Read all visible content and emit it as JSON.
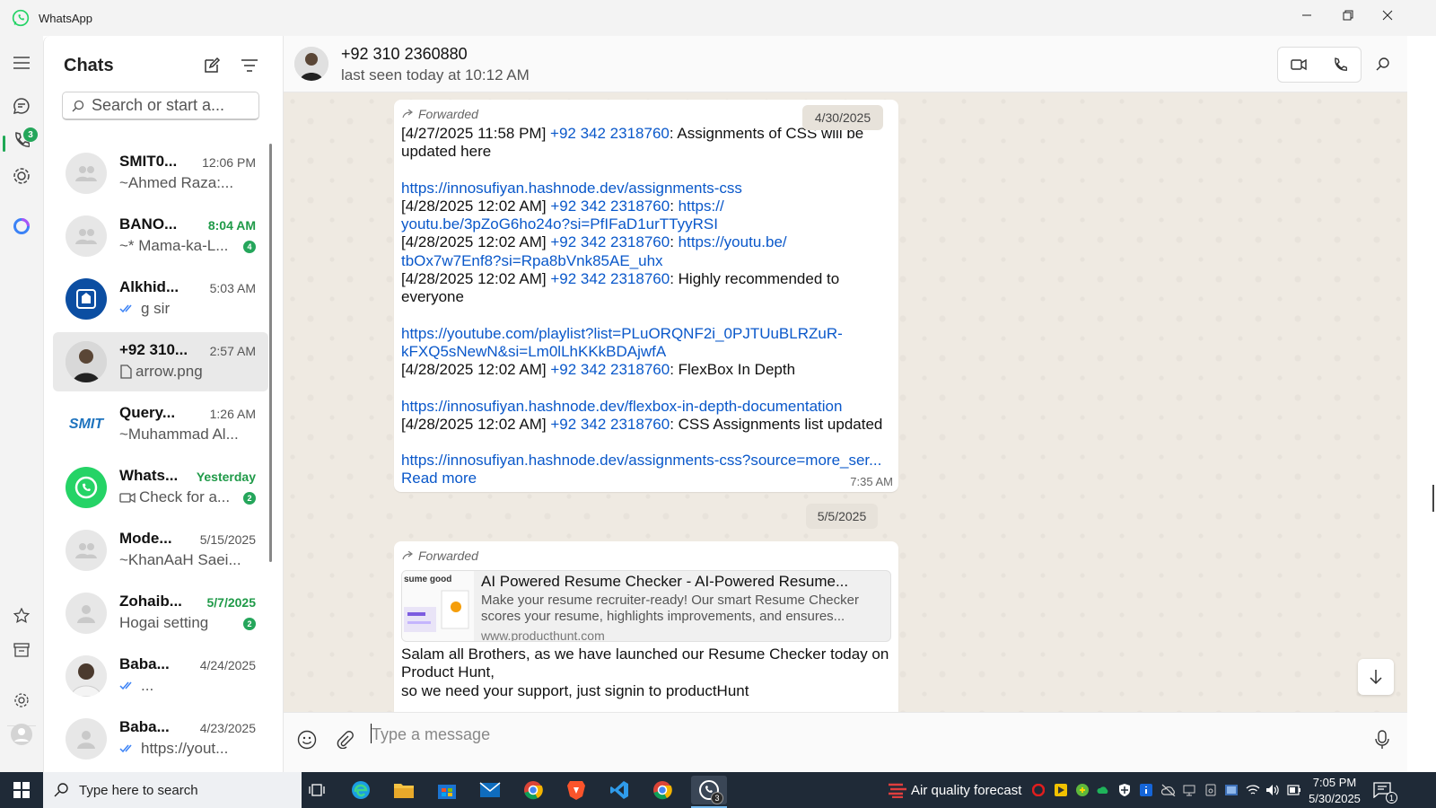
{
  "window": {
    "app_title": "WhatsApp"
  },
  "rail": {
    "chats_badge": "3"
  },
  "sidebar": {
    "title": "Chats",
    "search_placeholder": "Search or start a...",
    "chats": [
      {
        "name": "SMIT0...",
        "time": "12:06 PM",
        "preview": "~Ahmed Raza:...",
        "badge": ""
      },
      {
        "name": "BANO...",
        "time": "8:04 AM",
        "preview": "~* Mama-ka-L...",
        "badge": "4"
      },
      {
        "name": "Alkhid...",
        "time": "5:03 AM",
        "preview": "g sir",
        "badge": ""
      },
      {
        "name": "+92 310...",
        "time": "2:57 AM",
        "preview": "arrow.png",
        "badge": ""
      },
      {
        "name": "Query...",
        "time": "1:26 AM",
        "preview": "~Muhammad Al...",
        "badge": ""
      },
      {
        "name": "Whats...",
        "time": "Yesterday",
        "preview": "Check for a...",
        "badge": "2"
      },
      {
        "name": "Mode...",
        "time": "5/15/2025",
        "preview": "~KhanAaH Saei...",
        "badge": ""
      },
      {
        "name": "Zohaib...",
        "time": "5/7/2025",
        "preview": "Hogai setting",
        "badge": "2"
      },
      {
        "name": "Baba...",
        "time": "4/24/2025",
        "preview": "...",
        "badge": ""
      },
      {
        "name": "Baba...",
        "time": "4/23/2025",
        "preview": "https://yout...",
        "badge": ""
      }
    ],
    "smit_logo_text": "SMIT"
  },
  "header": {
    "name": "+92 310 2360880",
    "status": "last seen today at 10:12 AM"
  },
  "messages": {
    "date1": "4/30/2025",
    "forwarded": "Forwarded",
    "m1": {
      "l1a": "[4/27/2025 11:58 PM] ",
      "phone": "+92 342 2318760",
      "l1b": ": Assignments of CSS will be",
      "l2": "updated here",
      "link1": "https://innosufiyan.hashnode.dev/assignments-css",
      "l4a": "[4/28/2025 12:02 AM] ",
      "l4b": ": ",
      "l4link": "https://",
      "l5link": "youtu.be/3pZoG6ho24o?si=PfIFaD1urTTyyRSI",
      "l6a": "[4/28/2025 12:02 AM] ",
      "l6b": ": ",
      "l6link": "https://youtu.be/",
      "l7link": "tbOx7w7Enf8?si=Rpa8bVnk85AE_uhx",
      "l8a": "[4/28/2025 12:02 AM] ",
      "l8b": ": Highly recommended to",
      "l9": "everyone",
      "link2a": "https://youtube.com/playlist?list=PLuORQNF2i_0PJTUuBLRZuR-",
      "link2b": "kFXQ5sNewN&si=Lm0lLhKKkBDAjwfA",
      "l12a": "[4/28/2025 12:02 AM] ",
      "l12b": ": FlexBox In Depth",
      "link3": "https://innosufiyan.hashnode.dev/flexbox-in-depth-documentation",
      "l15a": "[4/28/2025 12:02 AM] ",
      "l15b": ": CSS Assignments list updated",
      "link4": "https://innosufiyan.hashnode.dev/assignments-css?source=more_ser...",
      "readmore": "Read more",
      "time": "7:35 AM"
    },
    "date2": "5/5/2025",
    "m2": {
      "preview_title": "AI Powered Resume Checker - AI-Powered Resume...",
      "preview_desc": "Make your resume recruiter-ready! Our smart Resume Checker scores your resume, highlights improvements, and ensures...",
      "preview_url": "www.producthunt.com",
      "thumb_text": "sume good",
      "l1": "Salam all Brothers, as we have launched our Resume Checker today on",
      "l2": "Product Hunt,",
      "l3": "so we need your support, just signin to productHunt"
    }
  },
  "composer": {
    "placeholder": "Type a message"
  },
  "taskbar": {
    "search": "Type here to search",
    "weather": "Air quality forecast",
    "time": "7:05 PM",
    "date": "5/30/2025",
    "whatsapp_badge": "3",
    "notif_badge": "1"
  },
  "colors": {
    "accent": "#25a65b",
    "link": "#0a58ca",
    "chat_bg": "#efeae2"
  }
}
